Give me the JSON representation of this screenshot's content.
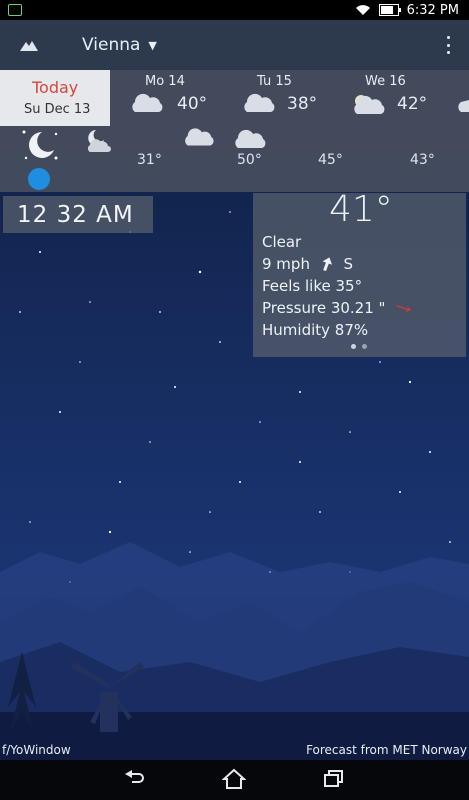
{
  "status": {
    "time": "6:32 PM"
  },
  "header": {
    "location": "Vienna"
  },
  "forecast": {
    "today": {
      "label": "Today",
      "date": "Su Dec 13"
    },
    "days": [
      {
        "name": "Mo 14",
        "temp": "40°",
        "icon": "cloud-icon"
      },
      {
        "name": "Tu 15",
        "temp": "38°",
        "icon": "cloud-icon"
      },
      {
        "name": "We 16",
        "temp": "42°",
        "icon": "partly-cloudy-icon"
      }
    ],
    "hours": [
      {
        "temp": "31°"
      },
      {
        "temp": "50°"
      },
      {
        "temp": "45°"
      },
      {
        "temp": "43°"
      }
    ]
  },
  "clock": {
    "time": "12  32 AM"
  },
  "current": {
    "temp": "41°",
    "condition": "Clear",
    "wind_speed": "9 mph",
    "wind_dir": "S",
    "feels_like": "Feels like 35°",
    "pressure": "Pressure 30.21 \"",
    "humidity": "Humidity 87%"
  },
  "footer": {
    "left": "f/YoWindow",
    "right": "Forecast from MET Norway"
  },
  "colors": {
    "today_accent": "#d2483c",
    "panel": "#505868",
    "sun_dot": "#1f8ee0",
    "pressure_arrow": "#d83a30"
  }
}
